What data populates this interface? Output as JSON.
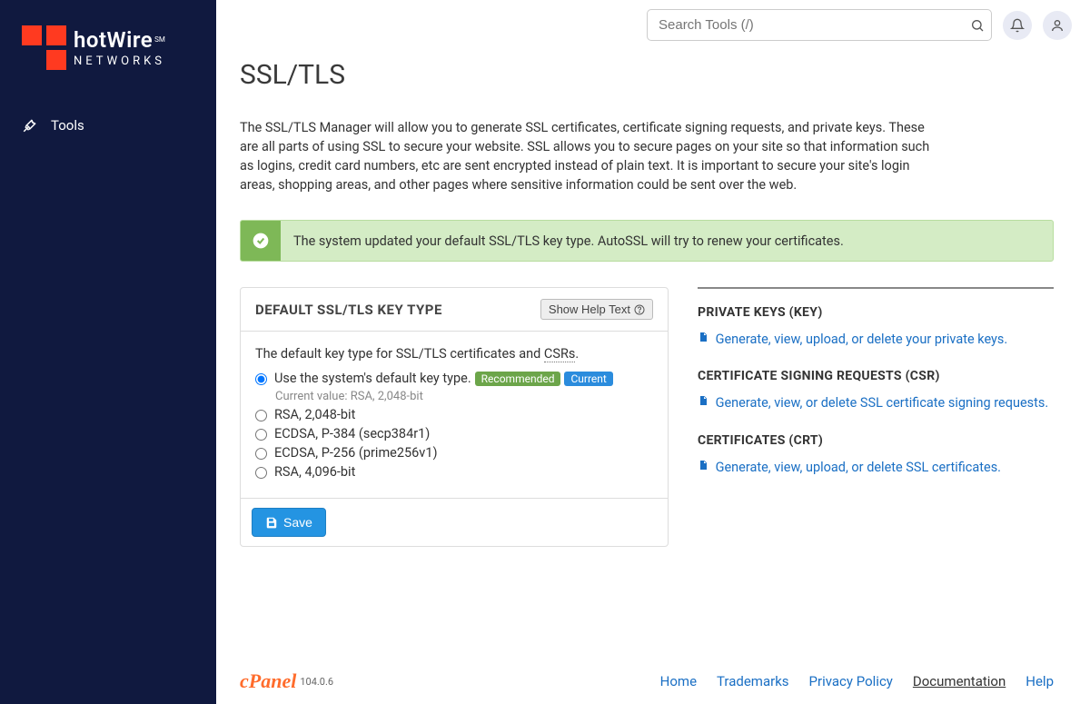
{
  "brand": {
    "name": "hotWire",
    "mark": "SM",
    "sub": "NETWORKS"
  },
  "nav": {
    "tools": "Tools"
  },
  "search": {
    "placeholder": "Search Tools (/)"
  },
  "page": {
    "title": "SSL/TLS",
    "intro": "The SSL/TLS Manager will allow you to generate SSL certificates, certificate signing requests, and private keys. These are all parts of using SSL to secure your website. SSL allows you to secure pages on your site so that information such as logins, credit card numbers, etc are sent encrypted instead of plain text. It is important to secure your site's login areas, shopping areas, and other pages where sensitive information could be sent over the web."
  },
  "alert": "The system updated your default SSL/TLS key type. AutoSSL will try to renew your certificates.",
  "card": {
    "title": "DEFAULT SSL/TLS KEY TYPE",
    "help": "Show Help Text",
    "desc_prefix": "The default key type for SSL/TLS certificates and ",
    "desc_abbr": "CSRs",
    "desc_suffix": ".",
    "options": [
      {
        "label": "Use the system's default key type.",
        "checked": true,
        "recommended": true,
        "current": true,
        "current_value": "Current value: RSA, 2,048-bit"
      },
      {
        "label": "RSA, 2,048-bit"
      },
      {
        "label": "ECDSA, P-384 (secp384r1)"
      },
      {
        "label": "ECDSA, P-256 (prime256v1)"
      },
      {
        "label": "RSA, 4,096-bit"
      }
    ],
    "badge_recommended": "Recommended",
    "badge_current": "Current",
    "save": "Save"
  },
  "right": {
    "sections": [
      {
        "title": "PRIVATE KEYS (KEY)",
        "link": "Generate, view, upload, or delete your private keys."
      },
      {
        "title": "CERTIFICATE SIGNING REQUESTS (CSR)",
        "link": "Generate, view, or delete SSL certificate signing requests."
      },
      {
        "title": "CERTIFICATES (CRT)",
        "link": "Generate, view, upload, or delete SSL certificates."
      }
    ]
  },
  "footer": {
    "cpanel": "cPanel",
    "version": "104.0.6",
    "links": [
      "Home",
      "Trademarks",
      "Privacy Policy",
      "Documentation",
      "Help"
    ]
  }
}
